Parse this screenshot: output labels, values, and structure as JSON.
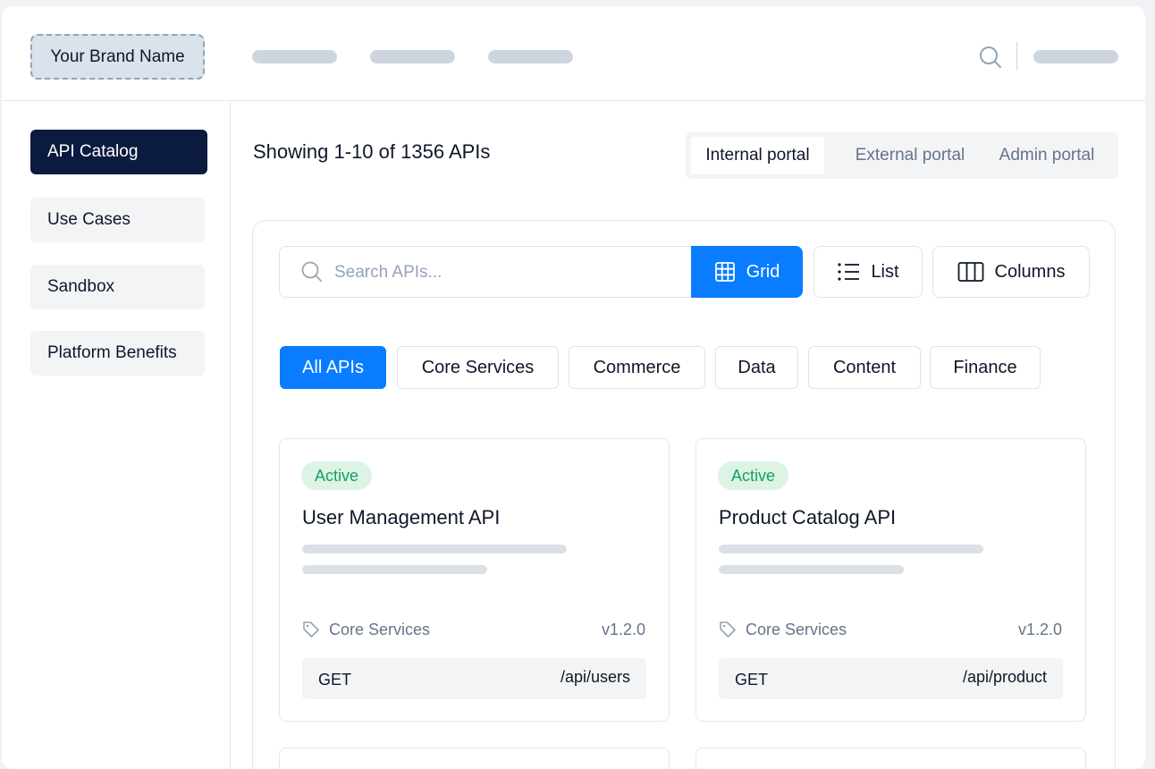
{
  "header": {
    "brand": "Your Brand Name"
  },
  "sidebar": {
    "items": [
      {
        "label": "API Catalog",
        "active": true
      },
      {
        "label": "Use Cases"
      },
      {
        "label": "Sandbox"
      },
      {
        "label": "Platform Benefits"
      }
    ]
  },
  "main": {
    "showing": "Showing 1-10 of 1356 APIs",
    "portals": [
      "Internal portal",
      "External portal",
      "Admin portal"
    ],
    "search": {
      "placeholder": "Search APIs..."
    },
    "views": [
      "Grid",
      "List",
      "Columns"
    ],
    "filters": [
      "All APIs",
      "Core Services",
      "Commerce",
      "Data",
      "Content",
      "Finance"
    ],
    "cards": [
      {
        "status": "Active",
        "title": "User Management API",
        "category": "Core Services",
        "version": "v1.2.0",
        "method": "GET",
        "path": "/api/users"
      },
      {
        "status": "Active",
        "title": "Product Catalog API",
        "category": "Core Services",
        "version": "v1.2.0",
        "method": "GET",
        "path": "/api/product"
      }
    ]
  },
  "colors": {
    "accent": "#0a7cff",
    "sidebar_active": "#0b1b3f",
    "status_active_bg": "#dcf3e6",
    "status_active_text": "#13a25c"
  },
  "icons": {
    "search": "search-icon",
    "grid": "grid-icon",
    "list": "list-icon",
    "columns": "columns-icon",
    "tag": "tag-icon"
  }
}
